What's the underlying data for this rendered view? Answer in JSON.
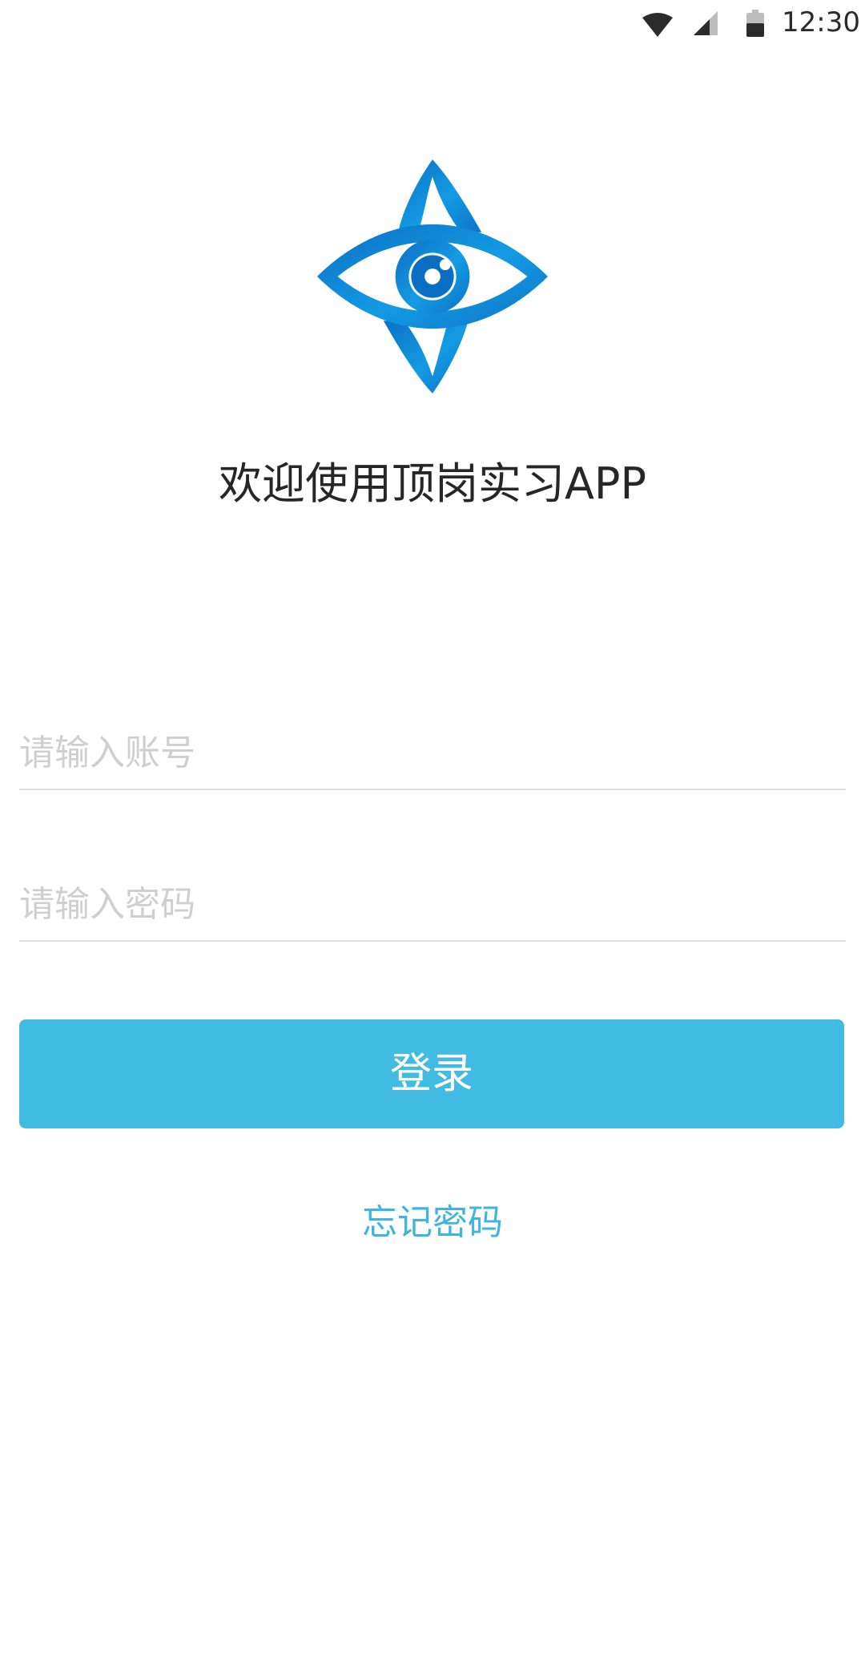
{
  "status_bar": {
    "time": "12:30",
    "icons": [
      "wifi-icon",
      "cell-signal-icon",
      "battery-icon"
    ]
  },
  "logo": {
    "icon": "eye-star-logo",
    "colors": {
      "dark_blue": "#0a6fc2",
      "light_blue": "#19a3e6"
    }
  },
  "welcome_text": "欢迎使用顶岗实习APP",
  "login_form": {
    "account_placeholder": "请输入账号",
    "password_placeholder": "请输入密码",
    "login_label": "登录",
    "forgot_password_label": "忘记密码"
  },
  "colors": {
    "button": "#42bbe3",
    "link": "#3fb4e0",
    "divider": "#dedede",
    "placeholder": "#cfcfcf"
  }
}
